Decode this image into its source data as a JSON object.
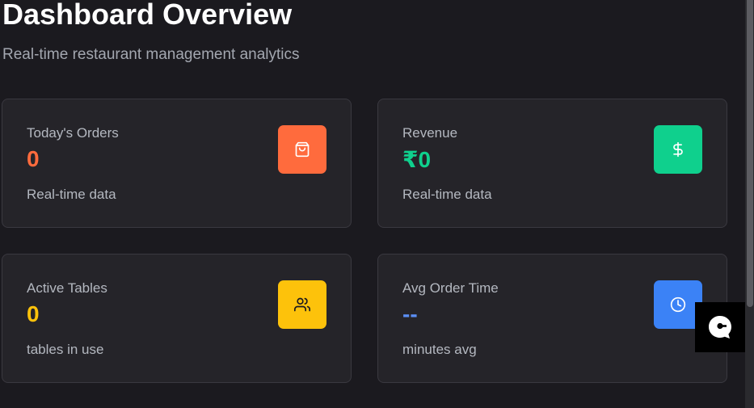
{
  "header": {
    "title": "Dashboard Overview",
    "subtitle": "Real-time restaurant management analytics"
  },
  "cards": [
    {
      "label": "Today's Orders",
      "value": "0",
      "note": "Real-time data",
      "icon": "shopping-bag-icon",
      "accent": "#ff6b3d"
    },
    {
      "label": "Revenue",
      "value": "₹0",
      "note": "Real-time data",
      "icon": "dollar-sign-icon",
      "accent": "#0fd08d"
    },
    {
      "label": "Active Tables",
      "value": "0",
      "note": "tables in use",
      "icon": "users-icon",
      "accent": "#fdc20b"
    },
    {
      "label": "Avg Order Time",
      "value": "--",
      "note": "minutes avg",
      "icon": "clock-icon",
      "accent": "#3b82f6"
    }
  ],
  "chat_widget": {
    "icon": "chat-bubble-icon"
  }
}
